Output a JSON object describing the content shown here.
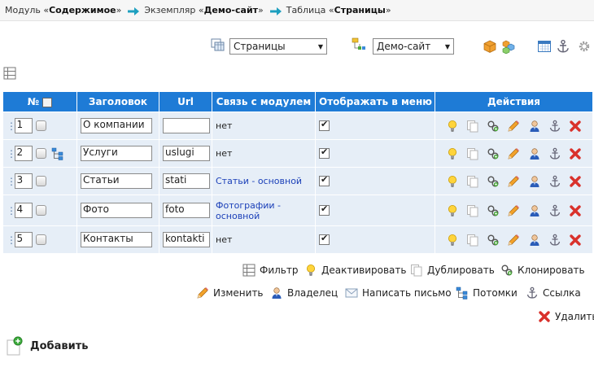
{
  "breadcrumb": {
    "module_prefix": "Модуль «",
    "module_name": "Содержимое",
    "module_suffix": "»",
    "instance_prefix": "Экземпляр «",
    "instance_name": "Демо-сайт",
    "instance_suffix": "»",
    "table_prefix": "Таблица «",
    "table_name": "Страницы",
    "table_suffix": "»"
  },
  "selectors": {
    "table_select": "Страницы",
    "site_select": "Демо-сайт"
  },
  "table": {
    "headers": {
      "num": "№",
      "title": "Заголовок",
      "url": "Url",
      "module": "Связь с модулем",
      "menu": "Отображать в меню",
      "actions": "Действия"
    },
    "rows": [
      {
        "num": "1",
        "title": "О компании",
        "url": "",
        "module": "нет"
      },
      {
        "num": "2",
        "title": "Услуги",
        "url": "uslugi",
        "module": "нет"
      },
      {
        "num": "3",
        "title": "Статьи",
        "url": "stati",
        "module": "Статьи - основной"
      },
      {
        "num": "4",
        "title": "Фото",
        "url": "foto",
        "module": "Фотографии - основной"
      },
      {
        "num": "5",
        "title": "Контакты",
        "url": "kontakti",
        "module": "нет"
      }
    ]
  },
  "actions": {
    "filter": "Фильтр",
    "deactivate": "Деактивировать",
    "duplicate": "Дублировать",
    "clone": "Клонировать",
    "edit": "Изменить",
    "owner": "Владелец",
    "write_letter": "Написать письмо",
    "children": "Потомки",
    "link": "Ссылка",
    "delete": "Удалить"
  },
  "add": {
    "label": "Добавить"
  },
  "colors": {
    "header_blue": "#1e7bd6",
    "row_bg": "#e6eef7",
    "link_blue": "#1a3fb8",
    "delete_red": "#d9312b"
  }
}
